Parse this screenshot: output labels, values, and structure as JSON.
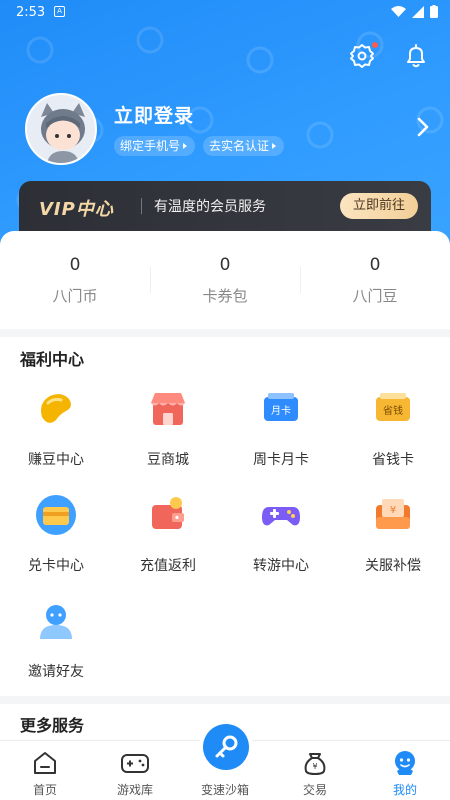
{
  "status_bar": {
    "time": "2:53",
    "a_icon": "A"
  },
  "header": {
    "login_label": "立即登录",
    "bind_phone_label": "绑定手机号",
    "verify_label": "去实名认证"
  },
  "vip": {
    "logo": "VIP中心",
    "tagline": "有温度的会员服务",
    "button_label": "立即前往"
  },
  "stats": [
    {
      "value": "0",
      "label": "八门币"
    },
    {
      "value": "0",
      "label": "卡券包"
    },
    {
      "value": "0",
      "label": "八门豆"
    }
  ],
  "welfare": {
    "title": "福利中心",
    "items": [
      {
        "label": "赚豆中心",
        "icon": "bean-icon"
      },
      {
        "label": "豆商城",
        "icon": "shop-icon"
      },
      {
        "label": "周卡月卡",
        "icon": "month-card-icon",
        "badge": "月卡"
      },
      {
        "label": "省钱卡",
        "icon": "save-card-icon",
        "badge": "省钱"
      },
      {
        "label": "兑卡中心",
        "icon": "exchange-card-icon"
      },
      {
        "label": "充值返利",
        "icon": "wallet-icon"
      },
      {
        "label": "转游中心",
        "icon": "gamepad-icon"
      },
      {
        "label": "关服补偿",
        "icon": "compensation-icon"
      },
      {
        "label": "邀请好友",
        "icon": "invite-icon"
      }
    ]
  },
  "more_services": {
    "title": "更多服务"
  },
  "tabbar": {
    "items": [
      {
        "label": "首页",
        "icon": "home-icon"
      },
      {
        "label": "游戏库",
        "icon": "game-library-icon"
      },
      {
        "label": "变速沙箱",
        "icon": "key-icon"
      },
      {
        "label": "交易",
        "icon": "trade-bag-icon"
      },
      {
        "label": "我的",
        "icon": "profile-icon"
      }
    ],
    "active_index": 4
  },
  "colors": {
    "primary": "#1f8bf7",
    "vip_bg": "#2d2f36",
    "vip_gold": "#f3d7a6"
  }
}
